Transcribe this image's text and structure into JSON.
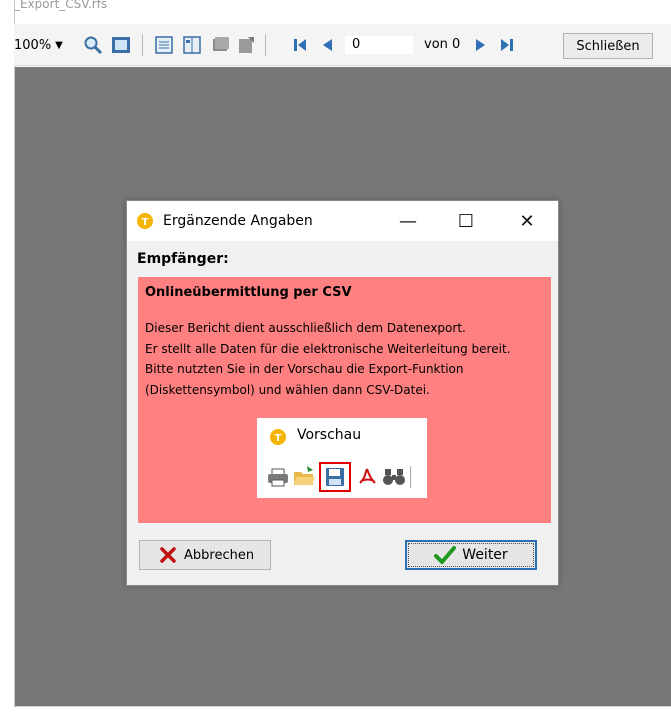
{
  "window": {
    "title_fragment": "_Export_CSV.rfs"
  },
  "toolbar": {
    "zoom_value": "100%",
    "page_value": "0",
    "page_total_label": "von 0",
    "close_label": "Schließen"
  },
  "dialog": {
    "title": "Ergänzende Angaben",
    "minimize": "—",
    "maximize": "☐",
    "close": "✕",
    "recipient_label": "Empfänger:",
    "info_title": "Onlineübermittlung per CSV",
    "info_lines": [
      "Dieser Bericht dient ausschließlich dem Datenexport.",
      "Er stellt alle Daten für die elektronische Weiterleitung bereit.",
      "Bitte nutzten Sie in der Vorschau die Export-Funktion",
      "(Diskettensymbol) und wählen dann CSV-Datei."
    ],
    "preview_title": "Vorschau",
    "cancel_label": "Abbrechen",
    "next_label": "Weiter"
  },
  "colors": {
    "info_background": "#ff8080",
    "canvas": "#777777",
    "accent_blue": "#2f6fb5",
    "highlight_red": "#e00000"
  },
  "icons": {
    "toolbar": [
      "zoom-icon",
      "page-view-icon",
      "single-page-icon",
      "two-page-icon",
      "thumbnails-icon",
      "page-edit-icon",
      "first-page-icon",
      "prev-page-icon",
      "next-page-icon",
      "last-page-icon"
    ],
    "preview": [
      "print-icon",
      "open-folder-icon",
      "save-disk-icon",
      "pdf-icon",
      "find-binoculars-icon"
    ]
  }
}
